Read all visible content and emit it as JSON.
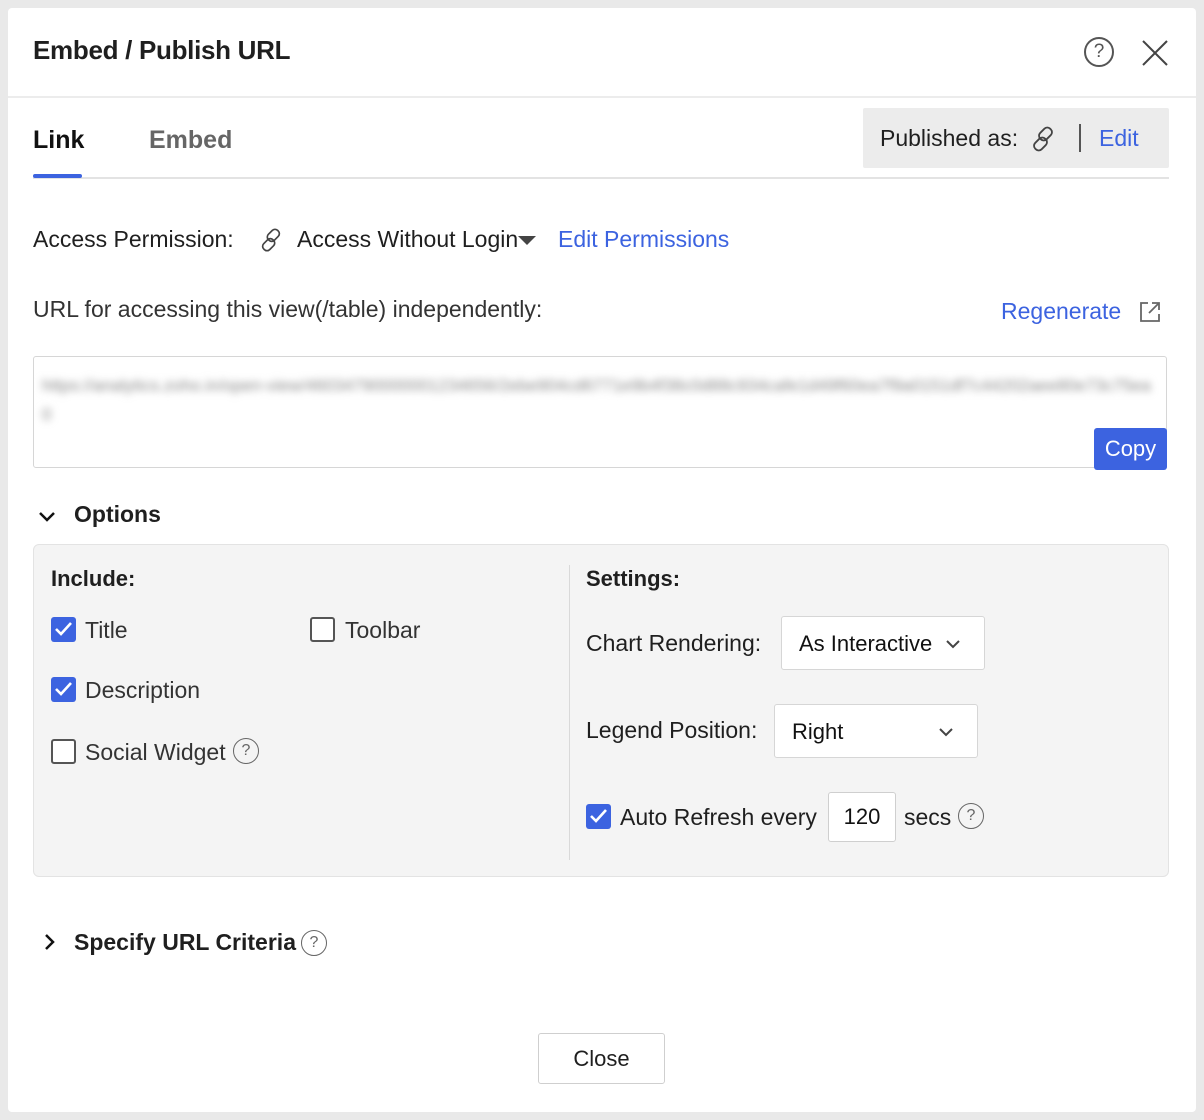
{
  "dialog": {
    "title": "Embed / Publish URL",
    "help_glyph": "?"
  },
  "tabs": [
    {
      "label": "Link",
      "active": true
    },
    {
      "label": "Embed",
      "active": false
    }
  ],
  "published": {
    "label": "Published as:",
    "icon": "link-icon",
    "edit_label": "Edit"
  },
  "access": {
    "label": "Access Permission:",
    "value": "Access Without Login",
    "edit_permissions_label": "Edit Permissions"
  },
  "url": {
    "label": "URL for accessing this view(/table) independently:",
    "regenerate_label": "Regenerate",
    "value": "https://analytics.zoho.in/open-view/46034790000001234656/2ebe904cd6771e9b4f38c0d88c934cafe1d49f60ea7f9a0151df7c44202aee80e73c75ea0",
    "copy_label": "Copy"
  },
  "options": {
    "title": "Options",
    "include": {
      "title": "Include:",
      "items": [
        {
          "label": "Title",
          "checked": true
        },
        {
          "label": "Toolbar",
          "checked": false
        },
        {
          "label": "Description",
          "checked": true
        },
        {
          "label": "Social Widget",
          "checked": false
        }
      ]
    },
    "settings": {
      "title": "Settings:",
      "chart_rendering_label": "Chart Rendering:",
      "chart_rendering_value": "As Interactive",
      "legend_position_label": "Legend Position:",
      "legend_position_value": "Right",
      "auto_refresh_label": "Auto Refresh every",
      "auto_refresh_checked": true,
      "auto_refresh_value": "120",
      "auto_refresh_unit": "secs"
    }
  },
  "criteria": {
    "title": "Specify URL Criteria"
  },
  "footer": {
    "close_label": "Close"
  },
  "colors": {
    "accent": "#3c63e0",
    "panel_bg": "#f4f4f4"
  }
}
